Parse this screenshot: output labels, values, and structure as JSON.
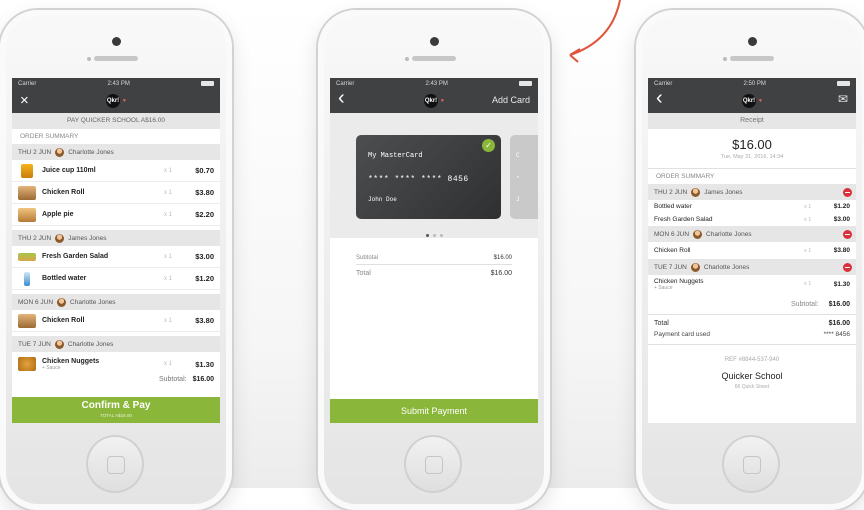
{
  "colors": {
    "accent_green": "#8ab73a",
    "nav_dark": "#3f4143",
    "remove_red": "#d9313c",
    "arrow_red": "#e0533b"
  },
  "phone1": {
    "status": {
      "carrier": "Carrier",
      "time": "2:43 PM"
    },
    "nav": {
      "close_icon": "×"
    },
    "logo": "Qkr!",
    "pay_label": "PAY QUICKER SCHOOL A$16.00",
    "section_label": "ORDER SUMMARY",
    "days": [
      {
        "date": "THU 2 JUN",
        "person": "Charlotte Jones",
        "items": [
          {
            "name": "Juice cup 110ml",
            "qty": "x 1",
            "price": "$0.70",
            "sub": ""
          },
          {
            "name": "Chicken Roll",
            "qty": "x 1",
            "price": "$3.80",
            "sub": ""
          },
          {
            "name": "Apple pie",
            "qty": "x 1",
            "price": "$2.20",
            "sub": ""
          }
        ]
      },
      {
        "date": "THU 2 JUN",
        "person": "James Jones",
        "items": [
          {
            "name": "Fresh Garden Salad",
            "qty": "x 1",
            "price": "$3.00",
            "sub": ""
          },
          {
            "name": "Bottled water",
            "qty": "x 1",
            "price": "$1.20",
            "sub": ""
          }
        ]
      },
      {
        "date": "MON 6 JUN",
        "person": "Charlotte Jones",
        "items": [
          {
            "name": "Chicken Roll",
            "qty": "x 1",
            "price": "$3.80",
            "sub": ""
          }
        ]
      },
      {
        "date": "TUE 7 JUN",
        "person": "Charlotte Jones",
        "items": [
          {
            "name": "Chicken Nuggets",
            "qty": "x 1",
            "price": "$1.30",
            "sub": "+ Sauce"
          }
        ]
      }
    ],
    "subtotal_label": "Subtotal:",
    "subtotal_value": "$16.00",
    "confirm_label": "Confirm & Pay",
    "confirm_sub": "TOTAL A$16.00"
  },
  "phone2": {
    "status": {
      "carrier": "Carrier",
      "time": "2:43 PM"
    },
    "nav": {
      "back_icon": "‹",
      "add_card": "Add Card"
    },
    "logo": "Qkr!",
    "card": {
      "name": "My MasterCard",
      "number": "**** **** **** 8456",
      "holder": "John Doe",
      "check_icon": "✓"
    },
    "ghost_card": {
      "l1": "C",
      "l2": "*",
      "l3": "J"
    },
    "subtotal_label": "Subtotal",
    "subtotal_value": "$16.00",
    "total_label": "Total",
    "total_value": "$16.00",
    "submit_label": "Submit Payment"
  },
  "phone3": {
    "status": {
      "carrier": "Carrier",
      "time": "2:50 PM"
    },
    "nav": {
      "back_icon": "‹",
      "mail_icon": "✉"
    },
    "logo": "Qkr!",
    "title": "Receipt",
    "amount": "$16.00",
    "date": "Tue, May 31, 2016, 14:34",
    "section_label": "ORDER SUMMARY",
    "days": [
      {
        "date": "THU 2 JUN",
        "person": "James Jones",
        "items": [
          {
            "name": "Bottled water",
            "qty": "x 1",
            "price": "$1.20",
            "sub": ""
          },
          {
            "name": "Fresh Garden Salad",
            "qty": "x 1",
            "price": "$3.00",
            "sub": ""
          }
        ]
      },
      {
        "date": "MON 6 JUN",
        "person": "Charlotte Jones",
        "items": [
          {
            "name": "Chicken Roll",
            "qty": "x 1",
            "price": "$3.80",
            "sub": ""
          }
        ]
      },
      {
        "date": "TUE 7 JUN",
        "person": "Charlotte Jones",
        "items": [
          {
            "name": "Chicken Nuggets",
            "qty": "x 1",
            "price": "$1.30",
            "sub": "+ Sauce"
          }
        ]
      }
    ],
    "subtotal_label": "Subtotal:",
    "subtotal_value": "$16.00",
    "total_label": "Total",
    "total_value": "$16.00",
    "payment_label": "Payment card used",
    "payment_value": "**** 8456",
    "ref": "REF #8844-537-940",
    "school": "Quicker School",
    "street": "66 Quick Street"
  }
}
